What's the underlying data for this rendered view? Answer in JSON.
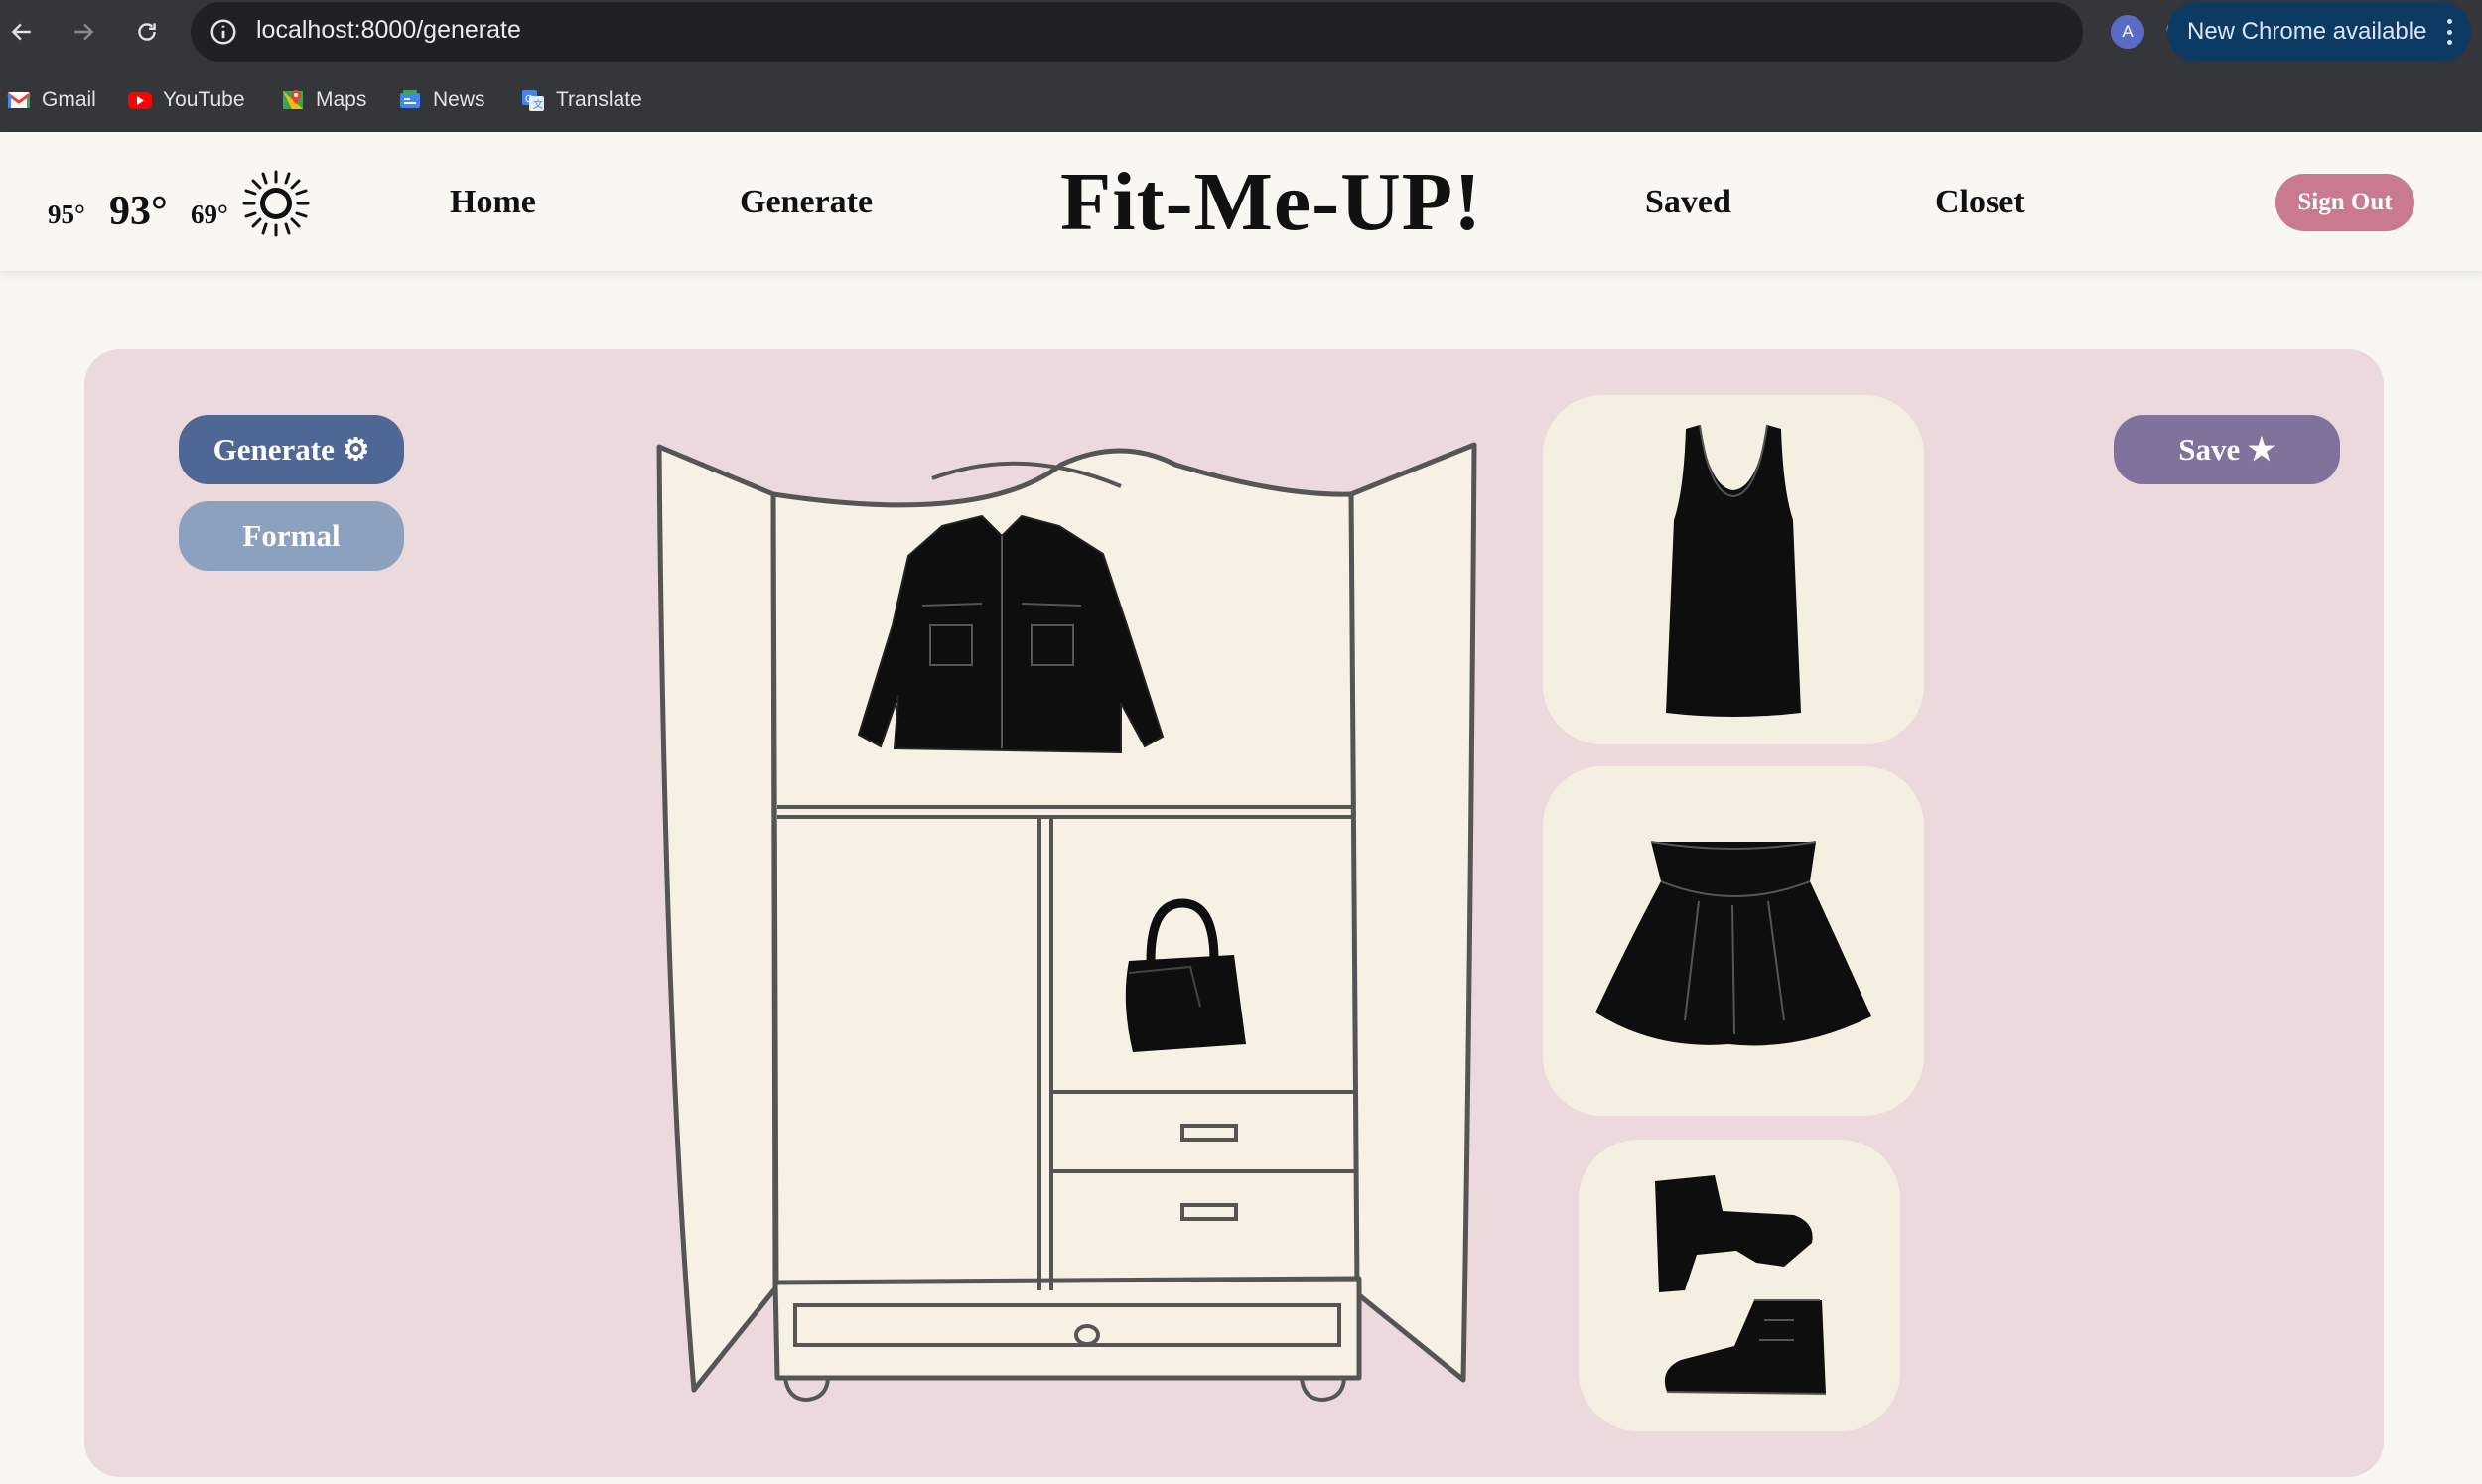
{
  "browser": {
    "url": "localhost:8000/generate",
    "profile_initial": "A",
    "update_label": "New Chrome available",
    "bookmarks": [
      {
        "label": "Gmail",
        "icon": "gmail-icon"
      },
      {
        "label": "YouTube",
        "icon": "youtube-icon"
      },
      {
        "label": "Maps",
        "icon": "maps-icon"
      },
      {
        "label": "News",
        "icon": "news-icon"
      },
      {
        "label": "Translate",
        "icon": "translate-icon"
      }
    ]
  },
  "header": {
    "weather": {
      "low": "95°",
      "current": "93°",
      "high": "69°",
      "icon": "sun-icon"
    },
    "nav": {
      "home": "Home",
      "generate": "Generate",
      "saved": "Saved",
      "closet": "Closet"
    },
    "brand": "Fit-Me-UP!",
    "sign_out": "Sign Out"
  },
  "main": {
    "generate_button": "Generate ⚙",
    "style_button": "Formal",
    "save_button": "Save ★",
    "wardrobe_items": [
      "jacket-icon",
      "handbag-icon"
    ],
    "outfit_items": [
      "tank-top-icon",
      "skirt-icon",
      "boots-icon"
    ]
  },
  "colors": {
    "panel": "#ecd9db",
    "card": "#f5efe2",
    "generate": "#4e6794",
    "formal": "#8ca0c0",
    "save": "#80729c",
    "sign_out": "#c97a8e"
  }
}
